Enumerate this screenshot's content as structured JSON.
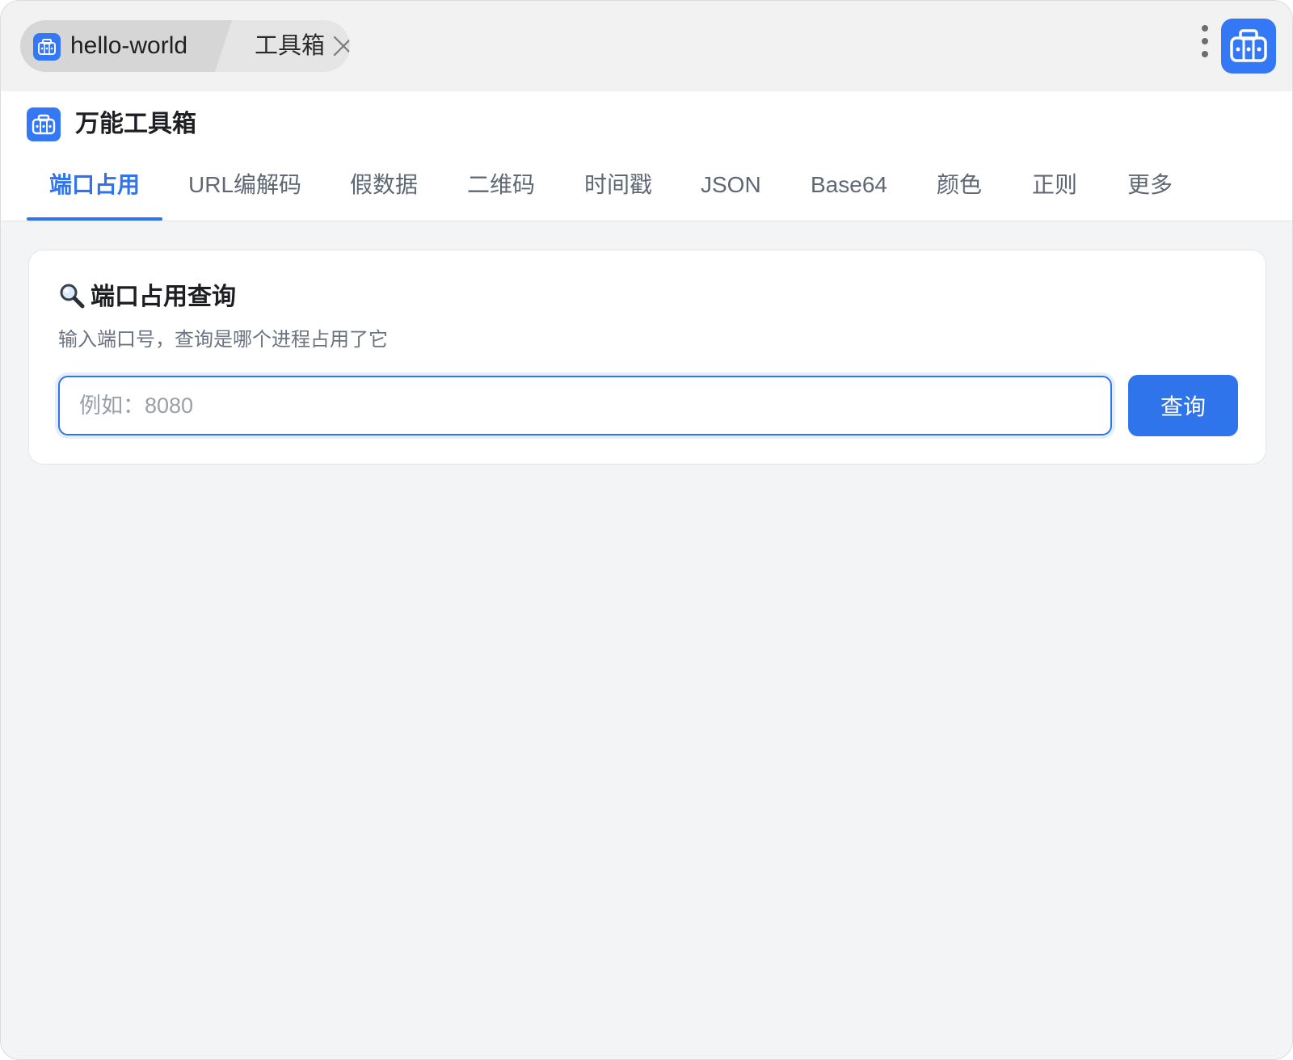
{
  "titlebar": {
    "app_name": "hello-world",
    "page_name": "工具箱",
    "app_icon": "toolbox-icon",
    "close_icon": "close-icon",
    "menu_icon": "more-vertical-icon",
    "corner_icon": "toolbox-icon"
  },
  "header": {
    "title": "万能工具箱",
    "icon": "toolbox-icon"
  },
  "tabs": [
    {
      "label": "端口占用",
      "active": true
    },
    {
      "label": "URL编解码",
      "active": false
    },
    {
      "label": "假数据",
      "active": false
    },
    {
      "label": "二维码",
      "active": false
    },
    {
      "label": "时间戳",
      "active": false
    },
    {
      "label": "JSON",
      "active": false
    },
    {
      "label": "Base64",
      "active": false
    },
    {
      "label": "颜色",
      "active": false
    },
    {
      "label": "正则",
      "active": false
    },
    {
      "label": "更多",
      "active": false
    }
  ],
  "card": {
    "title": "端口占用查询",
    "title_icon": "search-icon",
    "subtitle": "输入端口号，查询是哪个进程占用了它",
    "input_placeholder": "例如：8080",
    "input_value": "",
    "button_label": "查询"
  },
  "colors": {
    "accent": "#2f74eb",
    "app_icon": "#3478f6",
    "background": "#f3f4f6"
  }
}
